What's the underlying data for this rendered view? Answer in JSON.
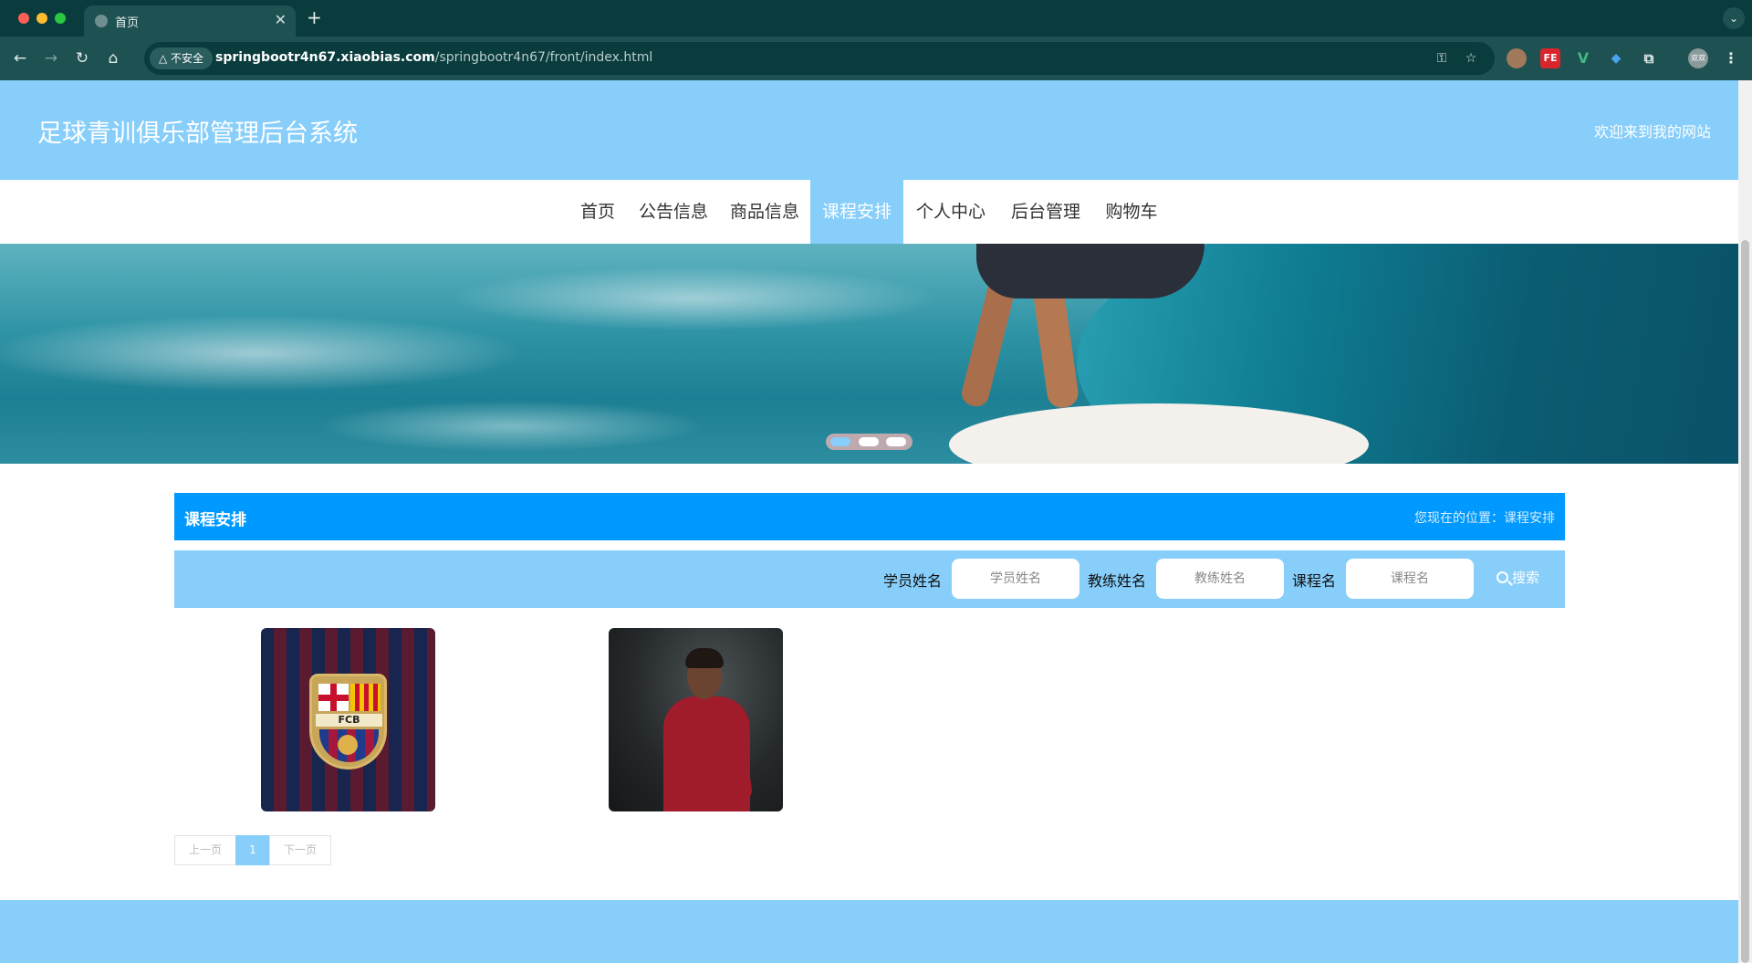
{
  "browser": {
    "tab_title": "首页",
    "tab_close": "✕",
    "new_tab": "+",
    "tab_menu": "⌄",
    "nav_icons": [
      "arrow-left-icon",
      "arrow-right-icon",
      "reload-icon",
      "home-icon"
    ],
    "security_chip": "△ 不安全",
    "url_host": "springbootr4n67.xiaobias.com",
    "url_path": "/springbootr4n67/front/index.html",
    "extensions": [
      "FE",
      "V"
    ],
    "profile_label": "双双"
  },
  "site": {
    "title": "足球青训俱乐部管理后台系统",
    "welcome": "欢迎来到我的网站"
  },
  "nav": {
    "items": [
      "首页",
      "公告信息",
      "商品信息",
      "课程安排",
      "个人中心",
      "后台管理",
      "购物车"
    ],
    "active_index": 3
  },
  "banner": {
    "slide_count": 3,
    "active_slide": 0
  },
  "section": {
    "title": "课程安排",
    "breadcrumb": "您现在的位置：课程安排"
  },
  "search": {
    "student_label": "学员姓名",
    "student_placeholder": "学员姓名",
    "coach_label": "教练姓名",
    "coach_placeholder": "教练姓名",
    "course_label": "课程名",
    "course_placeholder": "课程名",
    "button_label": "搜索"
  },
  "cards": [
    {
      "image": "fc-barcelona-crest-image",
      "crest_text": "FCB"
    },
    {
      "image": "liverpool-player-celebrating-image"
    }
  ],
  "pagination": {
    "prev_label": "上一页",
    "current_page": "1",
    "next_label": "下一页"
  },
  "colors": {
    "header": "#87cefa",
    "section_bar": "#0099ff",
    "browser_chrome": "#1e5152"
  }
}
